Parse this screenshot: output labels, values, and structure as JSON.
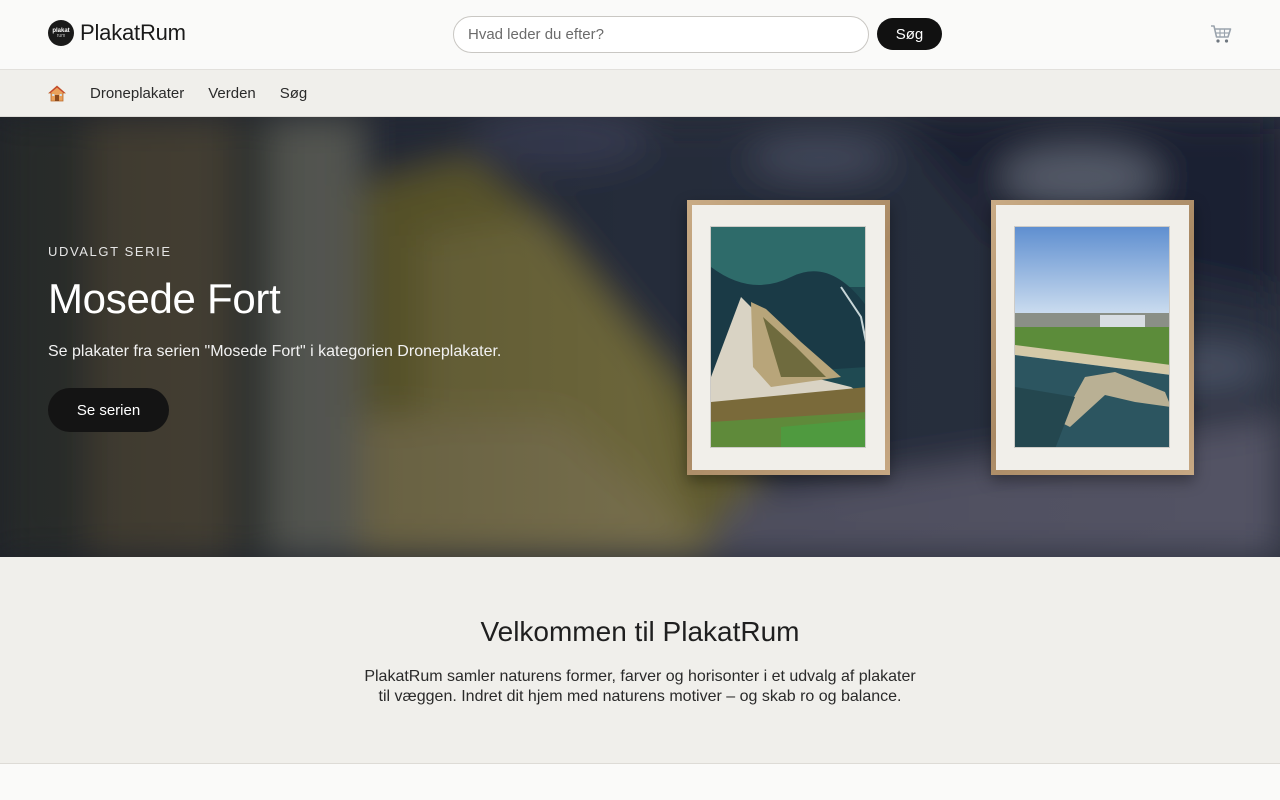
{
  "brand": {
    "logo_line1": "plakat",
    "logo_line2": "rum",
    "name": "PlakatRum"
  },
  "search": {
    "placeholder": "Hvad leder du efter?",
    "value": "",
    "button_label": "Søg"
  },
  "header": {
    "cart_icon": "cart-icon"
  },
  "nav": {
    "home_icon": "home-icon",
    "items": [
      {
        "label": "Droneplakater"
      },
      {
        "label": "Verden"
      },
      {
        "label": "Søg"
      }
    ]
  },
  "hero": {
    "eyebrow": "UDVALGT SERIE",
    "title": "Mosede Fort",
    "description": "Se plakater fra serien \"Mosede Fort\" i kategorien Droneplakater.",
    "button_label": "Se serien"
  },
  "welcome": {
    "title": "Velkommen til PlakatRum",
    "text": "PlakatRum samler naturens former, farver og horisonter i et udvalg af plakater til væggen. Indret dit hjem med naturens motiver – og skab ro og balance."
  },
  "colors": {
    "accent": "#111111",
    "background": "#fafaf9",
    "section_background": "#f0efeb"
  }
}
